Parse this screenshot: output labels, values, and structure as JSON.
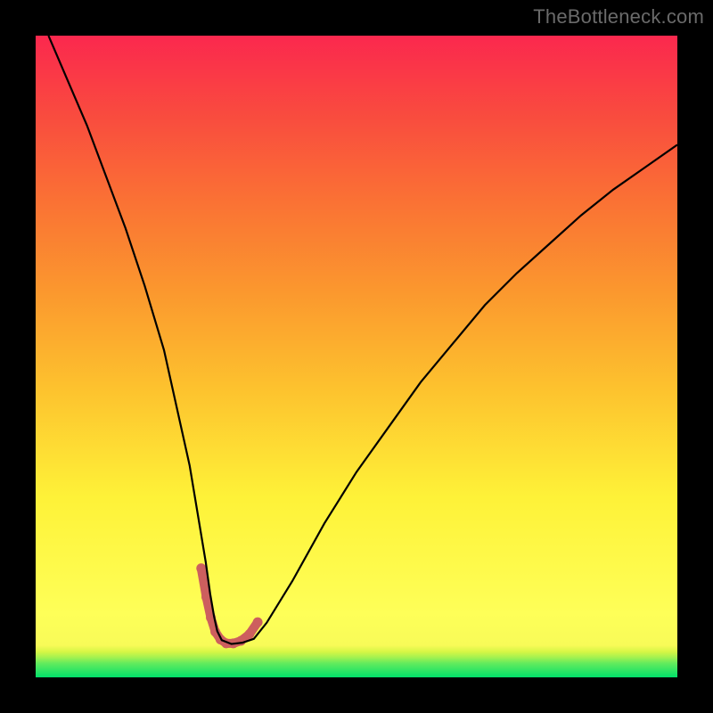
{
  "watermark": "TheBottleneck.com",
  "chart_data": {
    "type": "line",
    "title": "",
    "xlabel": "",
    "ylabel": "",
    "xlim": [
      0,
      100
    ],
    "ylim": [
      0,
      100
    ],
    "legend": false,
    "grid": false,
    "gradient_bands": [
      {
        "y": 0,
        "height": 6,
        "color": "#00e06a"
      },
      {
        "y": 6,
        "height": 4,
        "color": "#63eb5d"
      },
      {
        "y": 10,
        "height": 4,
        "color": "#a9f24f"
      },
      {
        "y": 14,
        "height": 4,
        "color": "#d7f645"
      },
      {
        "y": 18,
        "height": 10,
        "color": "#f8fb58"
      },
      {
        "y": 28,
        "height": 20,
        "color": "#fdee3e"
      },
      {
        "y": 48,
        "height": 10,
        "color": "#fdc22e"
      },
      {
        "y": 58,
        "height": 10,
        "color": "#fb982e"
      },
      {
        "y": 68,
        "height": 10,
        "color": "#fa7234"
      },
      {
        "y": 78,
        "height": 12,
        "color": "#f94a3f"
      },
      {
        "y": 90,
        "height": 10,
        "color": "#fb284e"
      }
    ],
    "series": [
      {
        "name": "bottleneck-curve",
        "color": "#000000",
        "stroke_width": 2.2,
        "x": [
          2,
          5,
          8,
          11,
          14,
          17,
          20,
          22,
          24,
          25.5,
          26.5,
          27.2,
          27.8,
          28.3,
          29.0,
          30.5,
          32.2,
          34.0,
          36,
          40,
          45,
          50,
          55,
          60,
          65,
          70,
          75,
          80,
          85,
          90,
          95,
          100
        ],
        "values": [
          100,
          93,
          86,
          78,
          70,
          61,
          51,
          42,
          33,
          24,
          18,
          13,
          9.5,
          7.2,
          5.8,
          5.2,
          5.4,
          6.0,
          8.5,
          15,
          24,
          32,
          39,
          46,
          52,
          58,
          63,
          67.5,
          72,
          76,
          79.5,
          83
        ]
      }
    ],
    "highlight": {
      "name": "bottom-band",
      "color": "#cd5f5e",
      "stroke_width": 10,
      "dot_radius": 5.5,
      "x": [
        25.8,
        26.6,
        27.3,
        28.0,
        28.8,
        29.7,
        30.8,
        32.0,
        33.3,
        34.6
      ],
      "values": [
        17.0,
        12.5,
        9.3,
        7.1,
        5.9,
        5.3,
        5.3,
        5.7,
        6.7,
        8.6
      ]
    }
  }
}
